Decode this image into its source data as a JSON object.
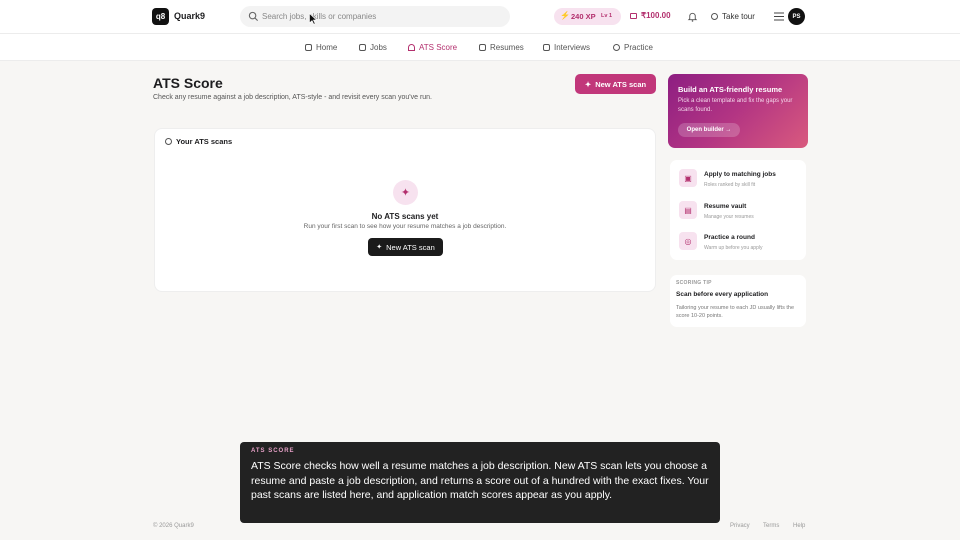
{
  "header": {
    "logo_mark": "q8",
    "brand": "Quark9",
    "search_placeholder": "Search jobs, skills or companies",
    "xp": "240 XP",
    "level": "Lv 1",
    "wallet": "₹100.00",
    "take_tour": "Take tour",
    "avatar_initials": "PS"
  },
  "nav": {
    "items": [
      {
        "label": "Home",
        "icon": "home-icon"
      },
      {
        "label": "Jobs",
        "icon": "document-icon"
      },
      {
        "label": "ATS Score",
        "icon": "gauge-icon"
      },
      {
        "label": "Resumes",
        "icon": "file-icon"
      },
      {
        "label": "Interviews",
        "icon": "video-icon"
      },
      {
        "label": "Practice",
        "icon": "target-icon"
      }
    ],
    "active": "ATS Score"
  },
  "main": {
    "title": "ATS Score",
    "subtitle": "Check any resume against a job description, ATS-style - and revisit every scan you've run.",
    "new_scan_button": "New ATS scan",
    "card": {
      "heading": "Your ATS scans",
      "empty_title": "No ATS scans yet",
      "empty_desc": "Run your first scan to see how your resume matches a job description.",
      "button": "New ATS scan"
    }
  },
  "sidebar": {
    "promo": {
      "title": "Build an ATS-friendly resume",
      "desc": "Pick a clean template and fix the gaps your scans found.",
      "button": "Open builder →"
    },
    "links": [
      {
        "title": "Apply to matching jobs",
        "sub": "Roles ranked by skill fit",
        "icon": "briefcase-icon"
      },
      {
        "title": "Resume vault",
        "sub": "Manage your resumes",
        "icon": "file-icon"
      },
      {
        "title": "Practice a round",
        "sub": "Warm up before you apply",
        "icon": "target-icon"
      }
    ],
    "tip": {
      "label": "SCORING TIP",
      "title": "Scan before every application",
      "desc": "Tailoring your resume to each JD usually lifts the score 10-20 points."
    }
  },
  "overlay": {
    "label": "ATS SCORE",
    "body": "ATS Score checks how well a resume matches a job description. New ATS scan lets you choose a resume and paste a job description, and returns a score out of a hundred with the exact fixes. Your past scans are listed here, and application match scores appear as you apply."
  },
  "footer": {
    "copyright": "© 2026 Quark9",
    "links": [
      "Privacy",
      "Terms",
      "Help"
    ]
  },
  "colors": {
    "accent": "#c1377a",
    "accent_soft": "#f7e2ef",
    "dark": "#1b1b1b"
  }
}
